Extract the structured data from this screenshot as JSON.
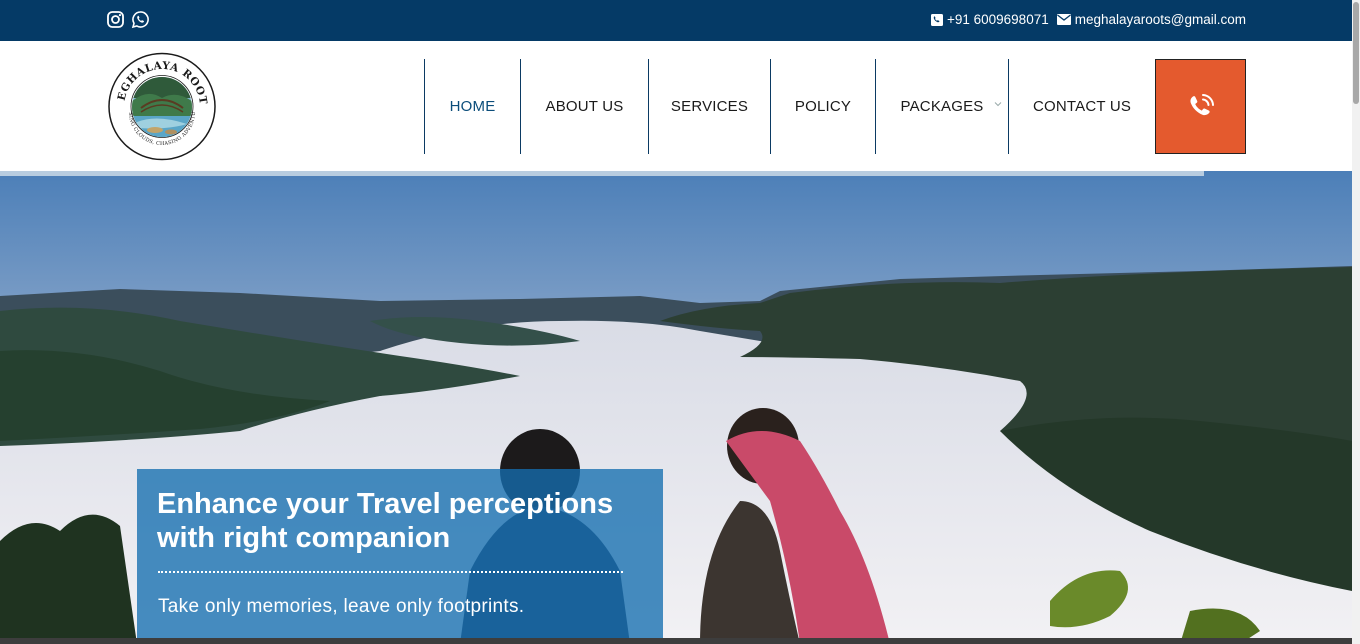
{
  "topbar": {
    "icons": [
      "instagram-icon",
      "whatsapp-icon",
      "phone-icon",
      "envelope-icon"
    ],
    "phone": "+91 6009698071",
    "email": "meghalayaroots@gmail.com",
    "background": "#053a66"
  },
  "logo": {
    "alt": "Meghalaya Roots logo",
    "top_text": "MEGHALAYA ROOTS",
    "tagline": "CHASING CLOUDS, CHASING ADVENTURES"
  },
  "nav": {
    "items": [
      {
        "label": "HOME",
        "active": true
      },
      {
        "label": "ABOUT US"
      },
      {
        "label": "SERVICES"
      },
      {
        "label": "POLICY"
      },
      {
        "label": "PACKAGES",
        "has_dropdown": true
      },
      {
        "label": "CONTACT US"
      }
    ],
    "call_button_icon": "phone-call-icon",
    "call_button_color": "#e45a2e"
  },
  "hero": {
    "heading": "Enhance your Travel perceptions with right companion",
    "subtext": "Take only memories, leave only footprints.",
    "overlay_color": "#146eaf"
  }
}
